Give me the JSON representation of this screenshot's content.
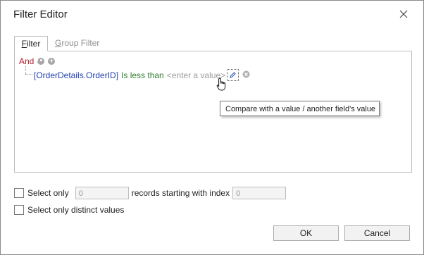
{
  "window": {
    "title": "Filter Editor"
  },
  "tabs": [
    {
      "label": "Filter",
      "accel": "F",
      "rest": "ilter"
    },
    {
      "label": "Group Filter",
      "accel": "G",
      "rest": "roup Filter"
    }
  ],
  "filter": {
    "group_operator": "And",
    "condition": {
      "field": "[OrderDetails.OrderID]",
      "operator": "Is less than",
      "value_placeholder": "<enter a value>"
    },
    "tooltip": "Compare with a value / another field's value"
  },
  "options": {
    "select_only_label": "Select only",
    "select_only_value": "0",
    "records_starting_label": "records starting with index",
    "start_index_value": "0",
    "distinct_label": "Select only distinct values"
  },
  "buttons": {
    "ok": "OK",
    "cancel": "Cancel"
  },
  "colors": {
    "and_operator": "#b0202a",
    "field": "#2040b0",
    "operator": "#2e7d2e",
    "placeholder": "#9a9a9a"
  },
  "icons": {
    "close": "close-icon",
    "group_options": "more-options-icon",
    "add_condition": "add-condition-icon",
    "edit_value": "pencil-icon",
    "remove_condition": "remove-condition-icon",
    "cursor": "hand-cursor-icon"
  }
}
